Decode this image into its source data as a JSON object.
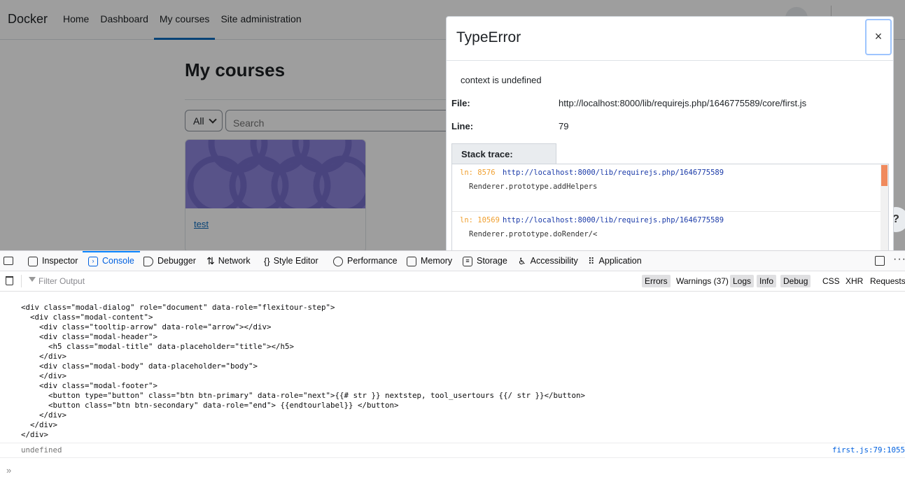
{
  "page": {
    "brand": "Docker",
    "nav": [
      "Home",
      "Dashboard",
      "My courses",
      "Site administration"
    ],
    "nav_active": "My courses",
    "heading": "My courses",
    "filter_select": "All",
    "search_placeholder": "Search",
    "course_link": "test",
    "help_label": "?"
  },
  "modal": {
    "title": "TypeError",
    "close_label": "×",
    "message": "context is undefined",
    "file_label": "File:",
    "file_value": "http://localhost:8000/lib/requirejs.php/1646775589/core/first.js",
    "line_label": "Line:",
    "line_value": "79",
    "stack_tab": "Stack trace:",
    "stack": [
      {
        "ln": "ln: 8576",
        "url": "http://localhost:8000/lib/requirejs.php/1646775589",
        "fn": "Renderer.prototype.addHelpers"
      },
      {
        "ln": "ln: 10569",
        "url": "http://localhost:8000/lib/requirejs.php/1646775589",
        "fn": "Renderer.prototype.doRender/<"
      }
    ]
  },
  "devtools": {
    "tabs": [
      {
        "label": "Inspector",
        "icon": "inspector-icon"
      },
      {
        "label": "Console",
        "icon": "console-icon"
      },
      {
        "label": "Debugger",
        "icon": "debugger-icon"
      },
      {
        "label": "Network",
        "icon": "network-icon"
      },
      {
        "label": "Style Editor",
        "icon": "style-editor-icon"
      },
      {
        "label": "Performance",
        "icon": "performance-icon"
      },
      {
        "label": "Memory",
        "icon": "memory-icon"
      },
      {
        "label": "Storage",
        "icon": "storage-icon"
      },
      {
        "label": "Accessibility",
        "icon": "accessibility-icon"
      },
      {
        "label": "Application",
        "icon": "application-icon"
      }
    ],
    "active_tab": "Console",
    "filter_placeholder": "Filter Output",
    "filters": [
      "Errors",
      "Warnings (37)",
      "Logs",
      "Info",
      "Debug"
    ],
    "filters_on": [
      "Errors",
      "Logs",
      "Info",
      "Debug"
    ],
    "request_filters": [
      "CSS",
      "XHR",
      "Requests"
    ],
    "console_output": "<div class=\"modal-dialog\" role=\"document\" data-role=\"flexitour-step\">\n  <div class=\"modal-content\">\n    <div class=\"tooltip-arrow\" data-role=\"arrow\"></div>\n    <div class=\"modal-header\">\n      <h5 class=\"modal-title\" data-placeholder=\"title\"></h5>\n    </div>\n    <div class=\"modal-body\" data-placeholder=\"body\">\n    </div>\n    <div class=\"modal-footer\">\n      <button type=\"button\" class=\"btn btn-primary\" data-role=\"next\">{{# str }} nextstep, tool_usertours {{/ str }}</button>\n      <button class=\"btn btn-secondary\" data-role=\"end\"> {{endtourlabel}} </button>\n    </div>\n  </div>\n</div>",
    "result": "undefined",
    "source_link": "first.js:79:1055",
    "prompt": "»"
  },
  "colors": {
    "accent": "#0f6cbf",
    "devtools_accent": "#0a84ff",
    "course_image": "#8e86de",
    "line_number": "#f0a030"
  }
}
